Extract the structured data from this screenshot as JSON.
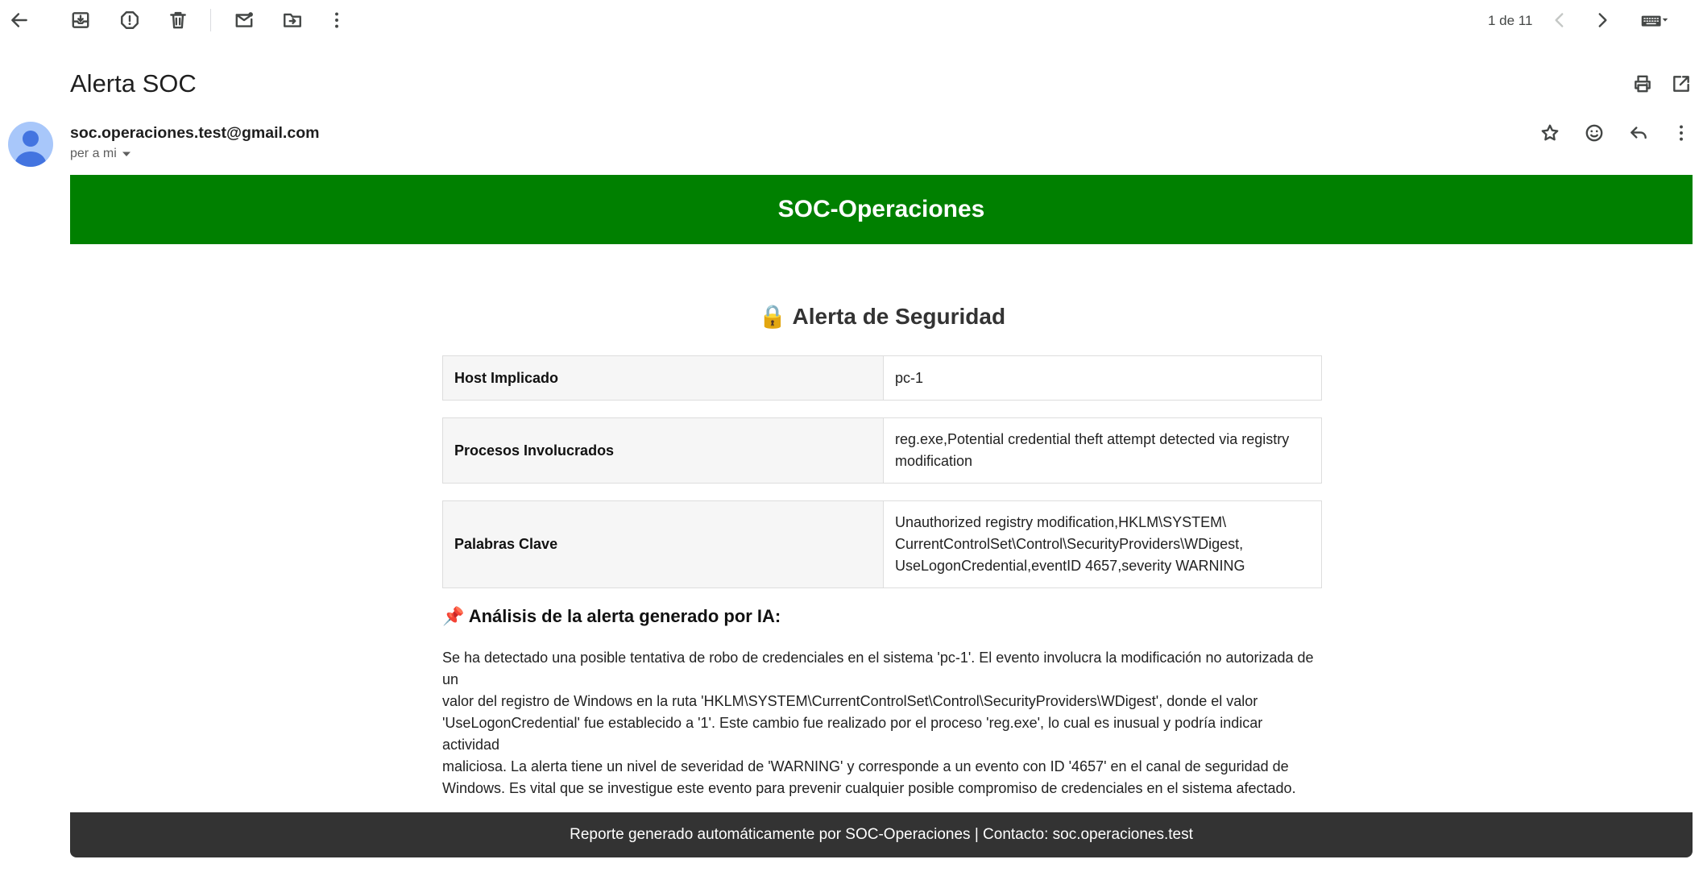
{
  "toolbar": {
    "back_icon": "arrow-back-icon",
    "archive_icon": "archive-icon",
    "spam_icon": "report-spam-icon",
    "delete_icon": "trash-icon",
    "mark_unread_icon": "mark-unread-icon",
    "move_icon": "move-to-folder-icon",
    "more_icon": "more-vert-icon",
    "pager_text": "1 de 11",
    "prev_icon": "chevron-left-icon",
    "next_icon": "chevron-right-icon",
    "input_tools_icon": "keyboard-icon"
  },
  "message": {
    "subject": "Alerta SOC",
    "sender": "soc.operaciones.test@gmail.com",
    "recipients_label": "per a mi",
    "print_icon": "print-icon",
    "open_new_window_icon": "open-in-new-icon",
    "star_icon": "star-icon",
    "emoji_icon": "emoji-icon",
    "reply_icon": "reply-icon",
    "more_icon": "more-vert-icon"
  },
  "email_body": {
    "banner_title": "SOC-Operaciones",
    "alert_icon": "🔒",
    "alert_title": "Alerta de Seguridad",
    "rows": [
      {
        "label": "Host Implicado",
        "value": "pc-1"
      },
      {
        "label": "Procesos Involucrados",
        "value_lines": [
          "reg.exe,Potential credential theft attempt detected via registry",
          "modification"
        ]
      },
      {
        "label": "Palabras Clave",
        "value_lines": [
          "Unauthorized registry modification,HKLM\\SYSTEM\\",
          "CurrentControlSet\\Control\\SecurityProviders\\WDigest,",
          "UseLogonCredential,eventID 4657,severity WARNING"
        ]
      }
    ],
    "analysis_icon": "📌",
    "analysis_heading": "Análisis de la alerta generado por IA:",
    "analysis_lines": [
      "Se ha detectado una posible tentativa de robo de credenciales en el sistema 'pc-1'. El evento involucra la modificación no autorizada de un",
      "valor del registro de Windows en la ruta 'HKLM\\SYSTEM\\CurrentControlSet\\Control\\SecurityProviders\\WDigest', donde el valor",
      "'UseLogonCredential' fue establecido a '1'. Este cambio fue realizado por el proceso 'reg.exe', lo cual es inusual y podría indicar actividad",
      "maliciosa. La alerta tiene un nivel de severidad de 'WARNING' y corresponde a un evento con ID '4657' en el canal de seguridad de",
      "Windows. Es vital que se investigue este evento para prevenir cualquier posible compromiso de credenciales en el sistema afectado."
    ],
    "footer_text": "Reporte generado automáticamente por SOC-Operaciones | Contacto: soc.operaciones.test"
  },
  "colors": {
    "banner": "#008000",
    "footer": "#333333",
    "avatar": "#a8c7fa"
  }
}
